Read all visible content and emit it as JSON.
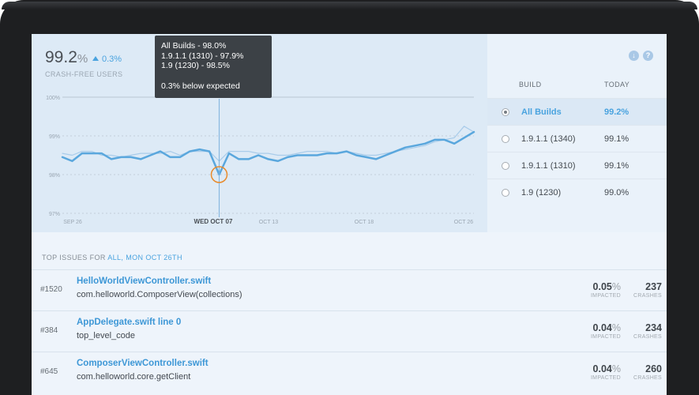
{
  "summary": {
    "value": "99.2",
    "unit": "%",
    "delta": "0.3%",
    "label": "CRASH-FREE USERS"
  },
  "tooltip": {
    "line1": "All Builds - 98.0%",
    "line2": "1.9.1.1 (1310) - 97.9%",
    "line3": "1.9 (1230) - 98.5%",
    "line4": "0.3% below expected"
  },
  "chart_data": {
    "type": "line",
    "ylim": [
      97,
      100
    ],
    "y_ticks": [
      "100%",
      "99%",
      "98%",
      "97%"
    ],
    "x_ticks": [
      "SEP 26",
      "",
      "WED OCT 07",
      "OCT 13",
      "OCT 18",
      "OCT 26"
    ],
    "highlight_label": "WED OCT 07",
    "grid": true,
    "series": [
      {
        "name": "All Builds",
        "color": "#5aa7dd",
        "values": [
          98.45,
          98.35,
          98.55,
          98.55,
          98.55,
          98.4,
          98.45,
          98.45,
          98.4,
          98.5,
          98.6,
          98.45,
          98.45,
          98.6,
          98.65,
          98.6,
          98.0,
          98.55,
          98.4,
          98.4,
          98.5,
          98.4,
          98.35,
          98.45,
          98.5,
          98.5,
          98.5,
          98.55,
          98.55,
          98.6,
          98.5,
          98.45,
          98.4,
          98.5,
          98.6,
          98.7,
          98.75,
          98.8,
          98.9,
          98.9,
          98.8,
          98.95,
          99.1
        ]
      },
      {
        "name": "Expected",
        "color": "#a9ccea",
        "values": [
          98.55,
          98.5,
          98.6,
          98.6,
          98.5,
          98.5,
          98.45,
          98.5,
          98.55,
          98.55,
          98.55,
          98.6,
          98.5,
          98.6,
          98.6,
          98.6,
          98.35,
          98.6,
          98.6,
          98.6,
          98.55,
          98.55,
          98.5,
          98.5,
          98.55,
          98.6,
          98.6,
          98.6,
          98.55,
          98.6,
          98.55,
          98.5,
          98.5,
          98.55,
          98.6,
          98.65,
          98.7,
          98.75,
          98.85,
          98.9,
          98.95,
          99.25,
          99.1
        ]
      }
    ]
  },
  "builds": {
    "col_build": "BUILD",
    "col_today": "TODAY",
    "rows": [
      {
        "name": "All Builds",
        "value": "99.2%"
      },
      {
        "name": "1.9.1.1 (1340)",
        "value": "99.1%"
      },
      {
        "name": "1.9.1.1 (1310)",
        "value": "99.1%"
      },
      {
        "name": "1.9 (1230)",
        "value": "99.0%"
      }
    ]
  },
  "issues": {
    "header_prefix": "TOP ISSUES FOR",
    "header_filter": "ALL, MON OCT 26TH",
    "impacted_label": "IMPACTED",
    "crashes_label": "CRASHES",
    "rows": [
      {
        "num": "#1520",
        "title": "HelloWorldViewController.swift",
        "sub": "com.helloworld.ComposerView(collections)",
        "impact": "0.05",
        "unit": "%",
        "crashes": "237"
      },
      {
        "num": "#384",
        "title": "AppDelegate.swift line 0",
        "sub": "top_level_code",
        "impact": "0.04",
        "unit": "%",
        "crashes": "234"
      },
      {
        "num": "#645",
        "title": "ComposerViewController.swift",
        "sub": "com.helloworld.core.getClient",
        "impact": "0.04",
        "unit": "%",
        "crashes": "260"
      }
    ]
  }
}
